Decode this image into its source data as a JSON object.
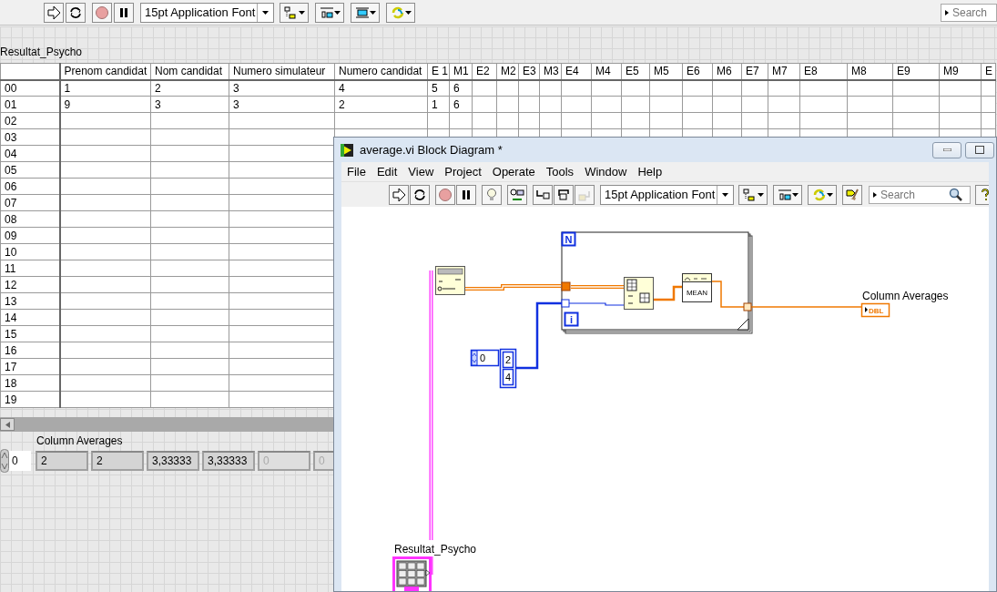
{
  "front_panel": {
    "toolbar": {
      "font": "15pt Application Font",
      "search_placeholder": "Search"
    },
    "table": {
      "label": "Resultat_Psycho",
      "columns": [
        "Prenom candidat",
        "Nom candidat",
        "Numero simulateur",
        "Numero candidat",
        "E 1",
        "M1",
        "E2",
        "M2",
        "E3",
        "M3",
        "E4",
        "M4",
        "E5",
        "M5",
        "E6",
        "M6",
        "E7",
        "M7",
        "E8",
        "M8",
        "E9",
        "M9",
        "E"
      ],
      "rows": [
        {
          "header": "00",
          "cells": [
            "1",
            "2",
            "3",
            "4",
            "5",
            "6"
          ]
        },
        {
          "header": "01",
          "cells": [
            "9",
            "3",
            "3",
            "2",
            "1",
            "6"
          ]
        },
        {
          "header": "02"
        },
        {
          "header": "03"
        },
        {
          "header": "04"
        },
        {
          "header": "05"
        },
        {
          "header": "06"
        },
        {
          "header": "07"
        },
        {
          "header": "08"
        },
        {
          "header": "09"
        },
        {
          "header": "10"
        },
        {
          "header": "11"
        },
        {
          "header": "12"
        },
        {
          "header": "13"
        },
        {
          "header": "14"
        },
        {
          "header": "15"
        },
        {
          "header": "16"
        },
        {
          "header": "17"
        },
        {
          "header": "18"
        },
        {
          "header": "19"
        }
      ]
    },
    "column_averages": {
      "label": "Column Averages",
      "index": "0",
      "elements": [
        {
          "value": "2",
          "disabled": false
        },
        {
          "value": "2",
          "disabled": false
        },
        {
          "value": "3,33333",
          "disabled": false
        },
        {
          "value": "3,33333",
          "disabled": false
        },
        {
          "value": "0",
          "disabled": true
        },
        {
          "value": "0",
          "disabled": true
        }
      ]
    }
  },
  "block_diagram": {
    "title": "average.vi Block Diagram *",
    "menu": [
      "File",
      "Edit",
      "View",
      "Project",
      "Operate",
      "Tools",
      "Window",
      "Help"
    ],
    "toolbar": {
      "font": "15pt Application Font",
      "search_placeholder": "Search"
    },
    "diagram": {
      "loop_count": "N",
      "loop_iteration": "i",
      "index_constant": "0",
      "array_constant": [
        "2",
        "4"
      ],
      "mean": "MEAN",
      "indicator_label": "Column Averages",
      "indicator_type": "DBL",
      "control_label": "Resultat_Psycho"
    }
  }
}
